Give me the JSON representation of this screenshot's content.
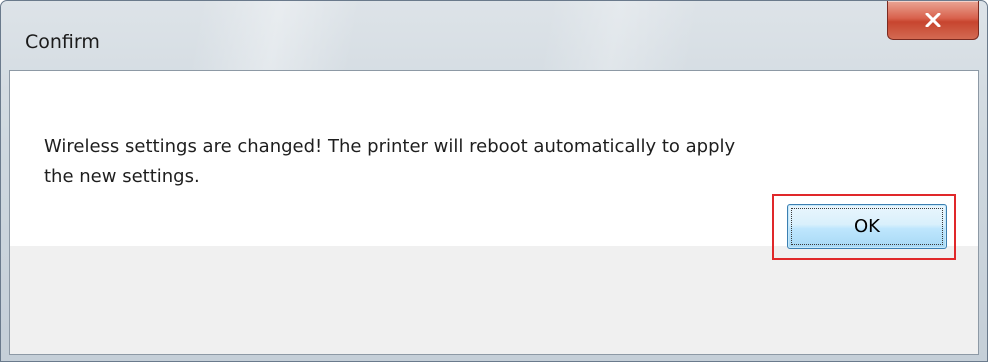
{
  "dialog": {
    "title": "Confirm",
    "message_line1": "Wireless settings are changed! The printer will reboot automatically to apply",
    "message_line2": "the new settings.",
    "ok_label": "OK",
    "close_icon": "close-x-icon"
  },
  "colors": {
    "close_button": "#c7452f",
    "ok_button_border": "#3c7fb1",
    "highlight_box": "#e0282a",
    "content_background": "#ffffff",
    "button_area_background": "#f0f0f0"
  }
}
